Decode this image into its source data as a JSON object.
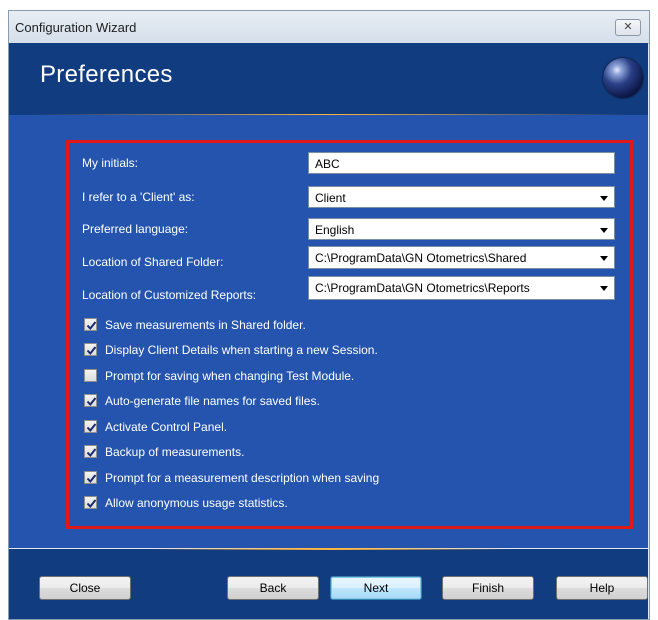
{
  "window": {
    "title": "Configuration Wizard",
    "close_glyph": "✕"
  },
  "header": {
    "title": "Preferences",
    "logo_icon": "globe-icon"
  },
  "fields": [
    {
      "label": "My initials:",
      "value": "ABC",
      "type": "text"
    },
    {
      "label": "I refer to a 'Client' as:",
      "value": "Client",
      "type": "dropdown"
    },
    {
      "label": "Preferred language:",
      "value": "English",
      "type": "dropdown"
    },
    {
      "label": "Location of Shared Folder:",
      "value": "C:\\ProgramData\\GN Otometrics\\Shared",
      "type": "dropdown"
    },
    {
      "label": "Location of Customized Reports:",
      "value": "C:\\ProgramData\\GN Otometrics\\Reports",
      "type": "dropdown"
    }
  ],
  "checkboxes": [
    {
      "label": "Save measurements in Shared folder.",
      "checked": true
    },
    {
      "label": "Display Client Details when starting a new Session.",
      "checked": true
    },
    {
      "label": "Prompt for saving when changing Test Module.",
      "checked": false
    },
    {
      "label": "Auto-generate file names for saved files.",
      "checked": true
    },
    {
      "label": "Activate Control Panel.",
      "checked": true
    },
    {
      "label": "Backup of measurements.",
      "checked": true
    },
    {
      "label": "Prompt for a measurement description when saving",
      "checked": true
    },
    {
      "label": "Allow anonymous usage statistics.",
      "checked": true
    }
  ],
  "buttons": {
    "close": "Close",
    "back": "Back",
    "next": "Next",
    "finish": "Finish",
    "help": "Help"
  },
  "colors": {
    "header_bg": "#123c80",
    "panel_bg": "#2454ad",
    "highlight_border": "#e01818",
    "accent_line": "#ffb43a"
  }
}
